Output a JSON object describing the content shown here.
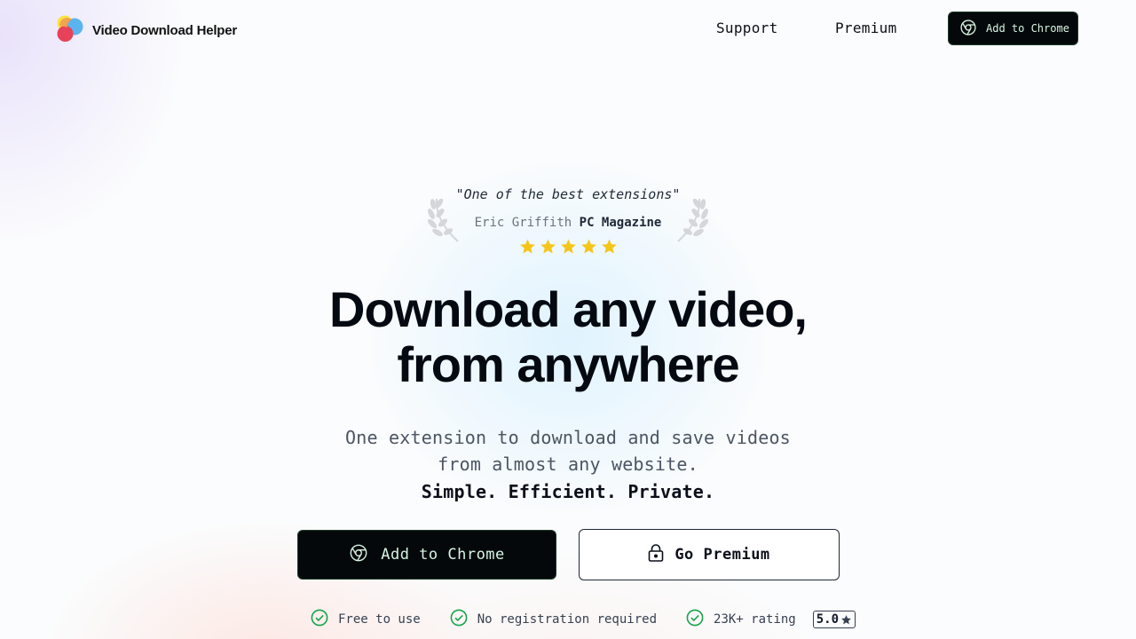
{
  "header": {
    "logo_text": "Video Download Helper",
    "nav": [
      {
        "label": "Support"
      },
      {
        "label": "Premium"
      }
    ],
    "cta_label": "Add to Chrome"
  },
  "quote": {
    "text": "\"One of the best extensions\"",
    "author": "Eric Griffith",
    "publication": "PC Magazine",
    "stars": 5
  },
  "hero": {
    "headline_line1": "Download any video,",
    "headline_line2": "from anywhere",
    "sub_line1": "One extension to download and save videos",
    "sub_line2": "from almost any website.",
    "sub_strong": "Simple. Efficient. Private."
  },
  "buttons": {
    "primary_label": "Add to Chrome",
    "secondary_label": "Go Premium"
  },
  "features": [
    {
      "label": "Free to use"
    },
    {
      "label": "No registration required"
    },
    {
      "label": "23K+ rating"
    }
  ],
  "rating_badge": "5.0",
  "colors": {
    "cta_bg": "#05080b",
    "cta_text": "#d7f5e3",
    "check_green": "#16a34a",
    "star_gold": "#f5c518"
  },
  "icons": {
    "logo": "logo-icon",
    "chrome": "chrome-icon",
    "lock": "lock-icon",
    "check": "check-circle-icon",
    "star": "star-icon",
    "laurel": "laurel-icon"
  }
}
